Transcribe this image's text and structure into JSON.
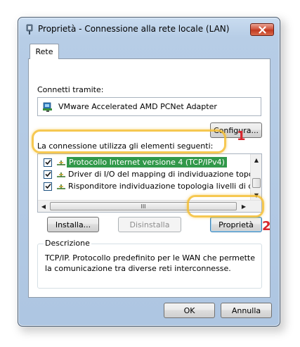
{
  "window": {
    "title": "Proprietà - Connessione alla rete locale (LAN)",
    "close_icon": "close-icon"
  },
  "tabs": [
    {
      "label": "Rete",
      "active": true
    }
  ],
  "connect_via": {
    "label": "Connetti tramite:",
    "adapter": "VMware Accelerated AMD PCNet Adapter",
    "configure_button": "Configura..."
  },
  "items": {
    "label": "La connessione utilizza gli elementi seguenti:",
    "rows": [
      {
        "checked": true,
        "text": "Protocollo Internet versione 4 (TCP/IPv4)",
        "selected": true
      },
      {
        "checked": true,
        "text": "Driver di I/O del mapping di individuazione topologia livelli",
        "selected": false
      },
      {
        "checked": true,
        "text": "Risponditore individuazione topologia livelli di collegamento",
        "selected": false
      }
    ],
    "hscroll_grip": "III"
  },
  "actions": {
    "install": "Installa...",
    "uninstall": "Disinstalla",
    "properties": "Proprietà"
  },
  "description": {
    "legend": "Descrizione",
    "text": "TCP/IP. Protocollo predefinito per le WAN che permette la comunicazione tra diverse reti interconnesse."
  },
  "footer": {
    "ok": "OK",
    "cancel": "Annulla"
  },
  "annotations": [
    {
      "number": "1"
    },
    {
      "number": "2"
    }
  ],
  "colors": {
    "selection": "#31984a",
    "highlight": "#f5be32",
    "marker": "#d8262e"
  }
}
